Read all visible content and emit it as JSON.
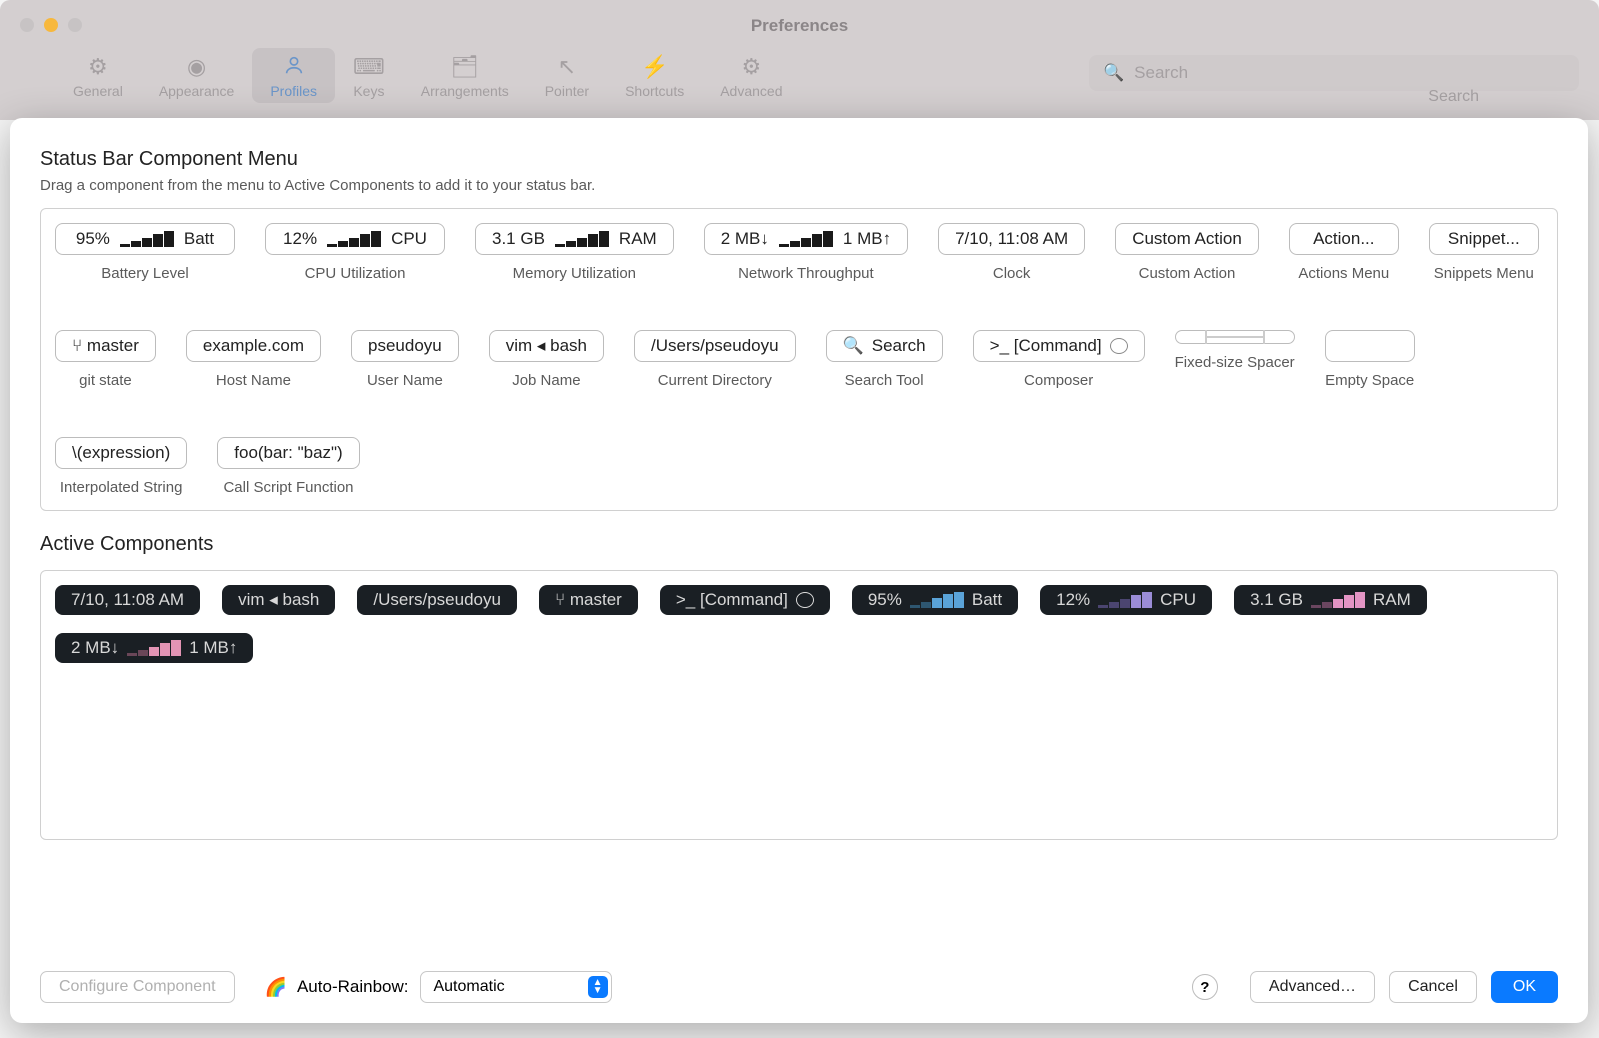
{
  "window": {
    "title": "Preferences",
    "search_placeholder": "Search",
    "search_label": "Search",
    "toolbar": [
      {
        "id": "general",
        "label": "General",
        "icon": "⚙",
        "active": false
      },
      {
        "id": "appearance",
        "label": "Appearance",
        "icon": "◉",
        "active": false
      },
      {
        "id": "profiles",
        "label": "Profiles",
        "icon": "👤",
        "active": true
      },
      {
        "id": "keys",
        "label": "Keys",
        "icon": "⌨",
        "active": false
      },
      {
        "id": "arrangements",
        "label": "Arrangements",
        "icon": "🗂",
        "active": false
      },
      {
        "id": "pointer",
        "label": "Pointer",
        "icon": "↖",
        "active": false
      },
      {
        "id": "shortcuts",
        "label": "Shortcuts",
        "icon": "⚡",
        "active": false
      },
      {
        "id": "advanced",
        "label": "Advanced",
        "icon": "⚙⚙",
        "active": false
      }
    ]
  },
  "menu": {
    "title": "Status Bar Component Menu",
    "subtitle": "Drag a component from the menu to Active Components to add it to your status bar.",
    "components": [
      {
        "id": "battery",
        "display": "95% ▁▃▅▇█ Batt",
        "pct": "95%",
        "suffix": "Batt",
        "hist": true,
        "label": "Battery Level"
      },
      {
        "id": "cpu",
        "display": "12% ▁▃▅▇█ CPU",
        "pct": "12%",
        "suffix": "CPU",
        "hist": true,
        "label": "CPU Utilization"
      },
      {
        "id": "memory",
        "display": "3.1 GB ▁▃▅▇█ RAM",
        "pct": "3.1 GB",
        "suffix": "RAM",
        "hist": true,
        "label": "Memory Utilization"
      },
      {
        "id": "network",
        "display": "2 MB↓ ▁▃▅▇█ 1 MB↑",
        "pct": "2 MB↓",
        "suffix": "1 MB↑",
        "hist": true,
        "label": "Network Throughput"
      },
      {
        "id": "clock",
        "display": "7/10, 11:08 AM",
        "label": "Clock"
      },
      {
        "id": "custom-action",
        "display": "Custom Action",
        "label": "Custom Action"
      },
      {
        "id": "actions-menu",
        "display": "Action...",
        "label": "Actions Menu"
      },
      {
        "id": "snippets-menu",
        "display": "Snippet...",
        "label": "Snippets Menu"
      },
      {
        "id": "git-state",
        "display": "⑂ master",
        "label": "git state"
      },
      {
        "id": "host-name",
        "display": "example.com",
        "label": "Host Name"
      },
      {
        "id": "user-name",
        "display": "pseudoyu",
        "label": "User Name"
      },
      {
        "id": "job-name",
        "display": "vim ◂ bash",
        "label": "Job Name"
      },
      {
        "id": "current-directory",
        "display": "/Users/pseudoyu",
        "label": "Current Directory"
      },
      {
        "id": "search-tool",
        "display": "🔍 Search",
        "label": "Search Tool"
      },
      {
        "id": "composer",
        "display": ">_ [Command] 💬",
        "label": "Composer"
      },
      {
        "id": "fixed-spacer",
        "display": "⊢——⊣",
        "spacer": true,
        "label": "Fixed-size Spacer"
      },
      {
        "id": "empty-space",
        "display": "",
        "empty": true,
        "label": "Empty Space"
      },
      {
        "id": "interpolated-string",
        "display": "\\(expression)",
        "label": "Interpolated String"
      },
      {
        "id": "call-script",
        "display": "foo(bar: \"baz\")",
        "label": "Call Script Function"
      }
    ]
  },
  "active": {
    "title": "Active Components",
    "items": [
      {
        "id": "clock",
        "text": "7/10, 11:08 AM",
        "color": "plain"
      },
      {
        "id": "job",
        "text": "vim ◂ bash",
        "color": "plain"
      },
      {
        "id": "cwd",
        "text": "/Users/pseudoyu",
        "color": "plain"
      },
      {
        "id": "git",
        "text": "⑂ master",
        "color": "plain"
      },
      {
        "id": "composer",
        "text": ">_ [Command] 💬",
        "color": "plain"
      },
      {
        "id": "batt",
        "text_pre": "95%",
        "text_post": "Batt",
        "hist": "blue"
      },
      {
        "id": "cpu",
        "text_pre": "12%",
        "text_post": "CPU",
        "hist": "purple"
      },
      {
        "id": "ram",
        "text_pre": "3.1 GB",
        "text_post": "RAM",
        "hist": "pink"
      },
      {
        "id": "net",
        "text_pre": "2 MB↓",
        "text_post": "1 MB↑",
        "hist": "pink2"
      }
    ]
  },
  "footer": {
    "configure": "Configure Component",
    "auto_rainbow_label": "Auto-Rainbow:",
    "auto_rainbow_value": "Automatic",
    "help": "?",
    "advanced": "Advanced…",
    "cancel": "Cancel",
    "ok": "OK"
  }
}
